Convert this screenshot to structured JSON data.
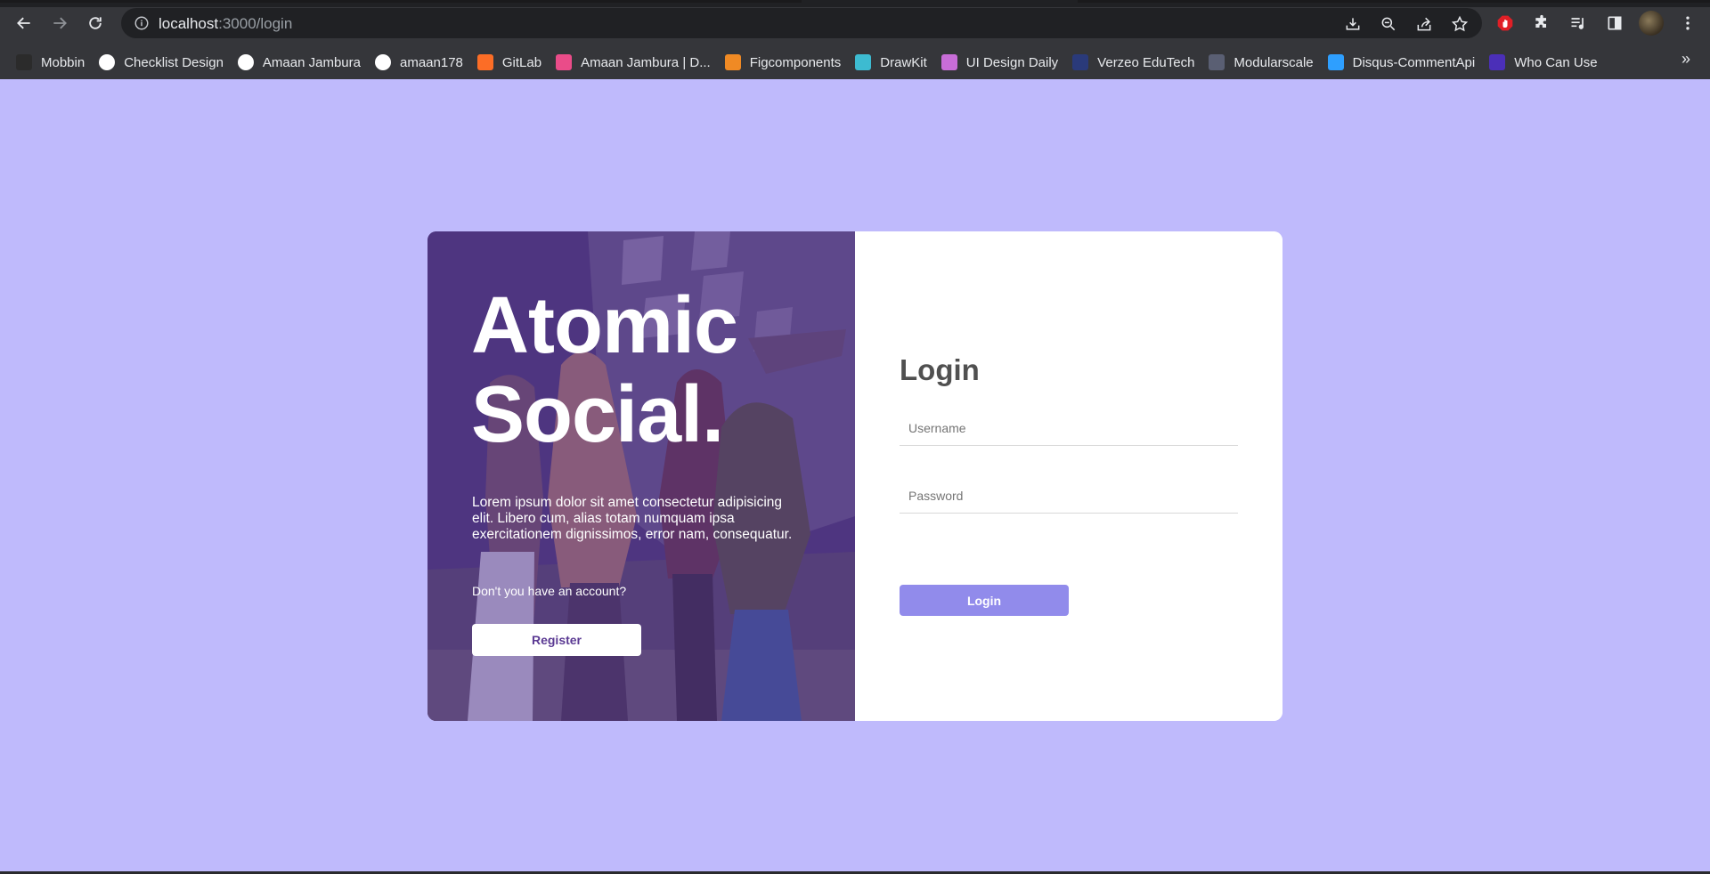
{
  "browser": {
    "url_host": "localhost",
    "url_path": ":3000/login",
    "icons": {
      "back": "arrow-left-icon",
      "forward": "arrow-right-icon",
      "reload": "reload-icon",
      "site_info": "info-icon",
      "install": "install-icon",
      "zoom": "zoom-out-icon",
      "share": "share-icon",
      "bookmark": "star-icon"
    }
  },
  "bookmarks": [
    {
      "label": "Mobbin",
      "icon": "mobbin-icon",
      "color": "#2b2b2b"
    },
    {
      "label": "Checklist Design",
      "icon": "checklist-icon",
      "color": "#ffffff"
    },
    {
      "label": "Amaan Jambura",
      "icon": "medium-icon",
      "color": "#ffffff"
    },
    {
      "label": "amaan178",
      "icon": "github-icon",
      "color": "#ffffff"
    },
    {
      "label": "GitLab",
      "icon": "gitlab-icon",
      "color": "#fc6d26"
    },
    {
      "label": "Amaan Jambura | D...",
      "icon": "dribbble-icon",
      "color": "#ea4c89"
    },
    {
      "label": "Figcomponents",
      "icon": "figcomponents-icon",
      "color": "#f08a24"
    },
    {
      "label": "DrawKit",
      "icon": "drawkit-icon",
      "color": "#3dbbd1"
    },
    {
      "label": "UI Design Daily",
      "icon": "ui-design-daily-icon",
      "color": "#c86dd7"
    },
    {
      "label": "Verzeo EduTech",
      "icon": "verzeo-icon",
      "color": "#2a3a7a"
    },
    {
      "label": "Modularscale",
      "icon": "modularscale-icon",
      "color": "#5a5f73"
    },
    {
      "label": "Disqus-CommentApi",
      "icon": "disqus-icon",
      "color": "#2e9fff"
    },
    {
      "label": "Who Can Use",
      "icon": "who-can-use-icon",
      "color": "#4b2fb8"
    }
  ],
  "bookmarks_more": "»",
  "hero": {
    "title_line1": "Atomic",
    "title_line2": "Social.",
    "description": "Lorem ipsum dolor sit amet consectetur adipisicing elit. Libero cum, alias totam numquam ipsa exercitationem dignissimos, error nam, consequatur.",
    "prompt": "Don't you have an account?",
    "register_label": "Register"
  },
  "login": {
    "title": "Login",
    "username_placeholder": "Username",
    "password_placeholder": "Password",
    "button_label": "Login"
  },
  "colors": {
    "page_background": "#bfbafc",
    "accent": "#918beb",
    "hero_tint": "#5b3a93"
  }
}
